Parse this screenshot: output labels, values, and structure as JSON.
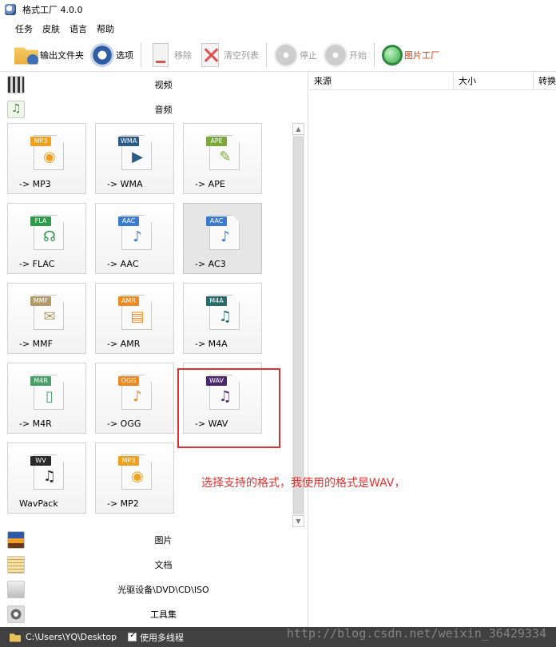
{
  "window": {
    "title": "格式工厂 4.0.0"
  },
  "menu": [
    "任务",
    "皮肤",
    "语言",
    "帮助"
  ],
  "toolbar": {
    "output_folder": "输出文件夹",
    "options": "选项",
    "remove": "移除",
    "clear_list": "清空列表",
    "stop": "停止",
    "start": "开始",
    "picture_factory": "图片工厂"
  },
  "categories": {
    "video": "视频",
    "audio": "音频",
    "image": "图片",
    "document": "文档",
    "disc": "光驱设备\\DVD\\CD\\ISO",
    "tools": "工具集"
  },
  "audio_formats": [
    {
      "tag": "MP3",
      "label": "-> MP3",
      "color": "#f0a020",
      "glyph": "◉"
    },
    {
      "tag": "WMA",
      "label": "-> WMA",
      "color": "#2a5c8a",
      "glyph": "▶"
    },
    {
      "tag": "APE",
      "label": "-> APE",
      "color": "#7aa83a",
      "glyph": "✎"
    },
    {
      "tag": "FLA",
      "label": "-> FLAC",
      "color": "#2f9a4a",
      "glyph": "☊"
    },
    {
      "tag": "AAC",
      "label": "-> AAC",
      "color": "#3a7ad0",
      "glyph": "♪"
    },
    {
      "tag": "AAC",
      "label": "-> AC3",
      "color": "#3a7ad0",
      "glyph": "♪"
    },
    {
      "tag": "MMF",
      "label": "-> MMF",
      "color": "#b09a6a",
      "glyph": "✉"
    },
    {
      "tag": "AMR",
      "label": "-> AMR",
      "color": "#f08a20",
      "glyph": "▤"
    },
    {
      "tag": "M4A",
      "label": "-> M4A",
      "color": "#2a6a6a",
      "glyph": "♫"
    },
    {
      "tag": "M4R",
      "label": "-> M4R",
      "color": "#4aa06a",
      "glyph": "▯"
    },
    {
      "tag": "OGG",
      "label": "-> OGG",
      "color": "#f08a20",
      "glyph": "♪"
    },
    {
      "tag": "WAV",
      "label": "-> WAV",
      "color": "#4a2a6a",
      "glyph": "♫"
    },
    {
      "tag": "WV",
      "label": "WavPack",
      "color": "#2a2a2a",
      "glyph": "♫"
    },
    {
      "tag": "MP3",
      "label": "-> MP2",
      "color": "#f0a020",
      "glyph": "◉"
    }
  ],
  "list_columns": [
    "来源",
    "大小",
    "转换"
  ],
  "annotation": {
    "note": "选择支持的格式，我使用的格式是WAV，"
  },
  "status": {
    "path": "C:\\Users\\YQ\\Desktop",
    "multithread": "使用多线程"
  },
  "watermark": "http://blog.csdn.net/weixin_36429334"
}
